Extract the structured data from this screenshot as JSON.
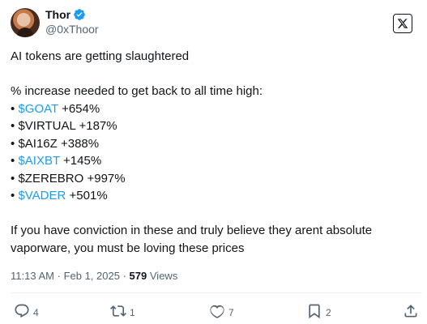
{
  "author": {
    "name": "Thor",
    "handle": "@0xThoor"
  },
  "post": {
    "intro": "AI tokens are getting slaughtered",
    "subhead": "% increase needed to get back to all time high:",
    "items": [
      {
        "bullet": "•",
        "ticker": "$GOAT",
        "linked": true,
        "change": "+654%"
      },
      {
        "bullet": "•",
        "ticker": "$VIRTUAL",
        "linked": false,
        "change": "+187%"
      },
      {
        "bullet": "•",
        "ticker": "$AI16Z",
        "linked": false,
        "change": "+388%"
      },
      {
        "bullet": "•",
        "ticker": "$AIXBT",
        "linked": true,
        "change": "+145%"
      },
      {
        "bullet": "•",
        "ticker": "$ZEREBRO",
        "linked": false,
        "change": "+997%"
      },
      {
        "bullet": "•",
        "ticker": "$VADER",
        "linked": true,
        "change": "+501%"
      }
    ],
    "closing": "If you have conviction in these and truly believe they arent absolute vaporware, you must be loving these prices"
  },
  "meta": {
    "time": "11:13 AM",
    "sep1": "·",
    "date": "Feb 1, 2025",
    "sep2": "·",
    "views_count": "579",
    "views_label": "Views"
  },
  "actions": {
    "replies": "4",
    "reposts": "1",
    "likes": "7",
    "bookmarks": "2"
  },
  "icons": {
    "verified": "verified-badge-icon",
    "brand": "x-logo-icon",
    "reply": "reply-icon",
    "repost": "repost-icon",
    "like": "heart-icon",
    "bookmark": "bookmark-icon",
    "share": "share-icon"
  },
  "colors": {
    "text": "#0f1419",
    "secondary": "#536471",
    "link": "#1d9bf0",
    "verified": "#1d9bf0"
  }
}
